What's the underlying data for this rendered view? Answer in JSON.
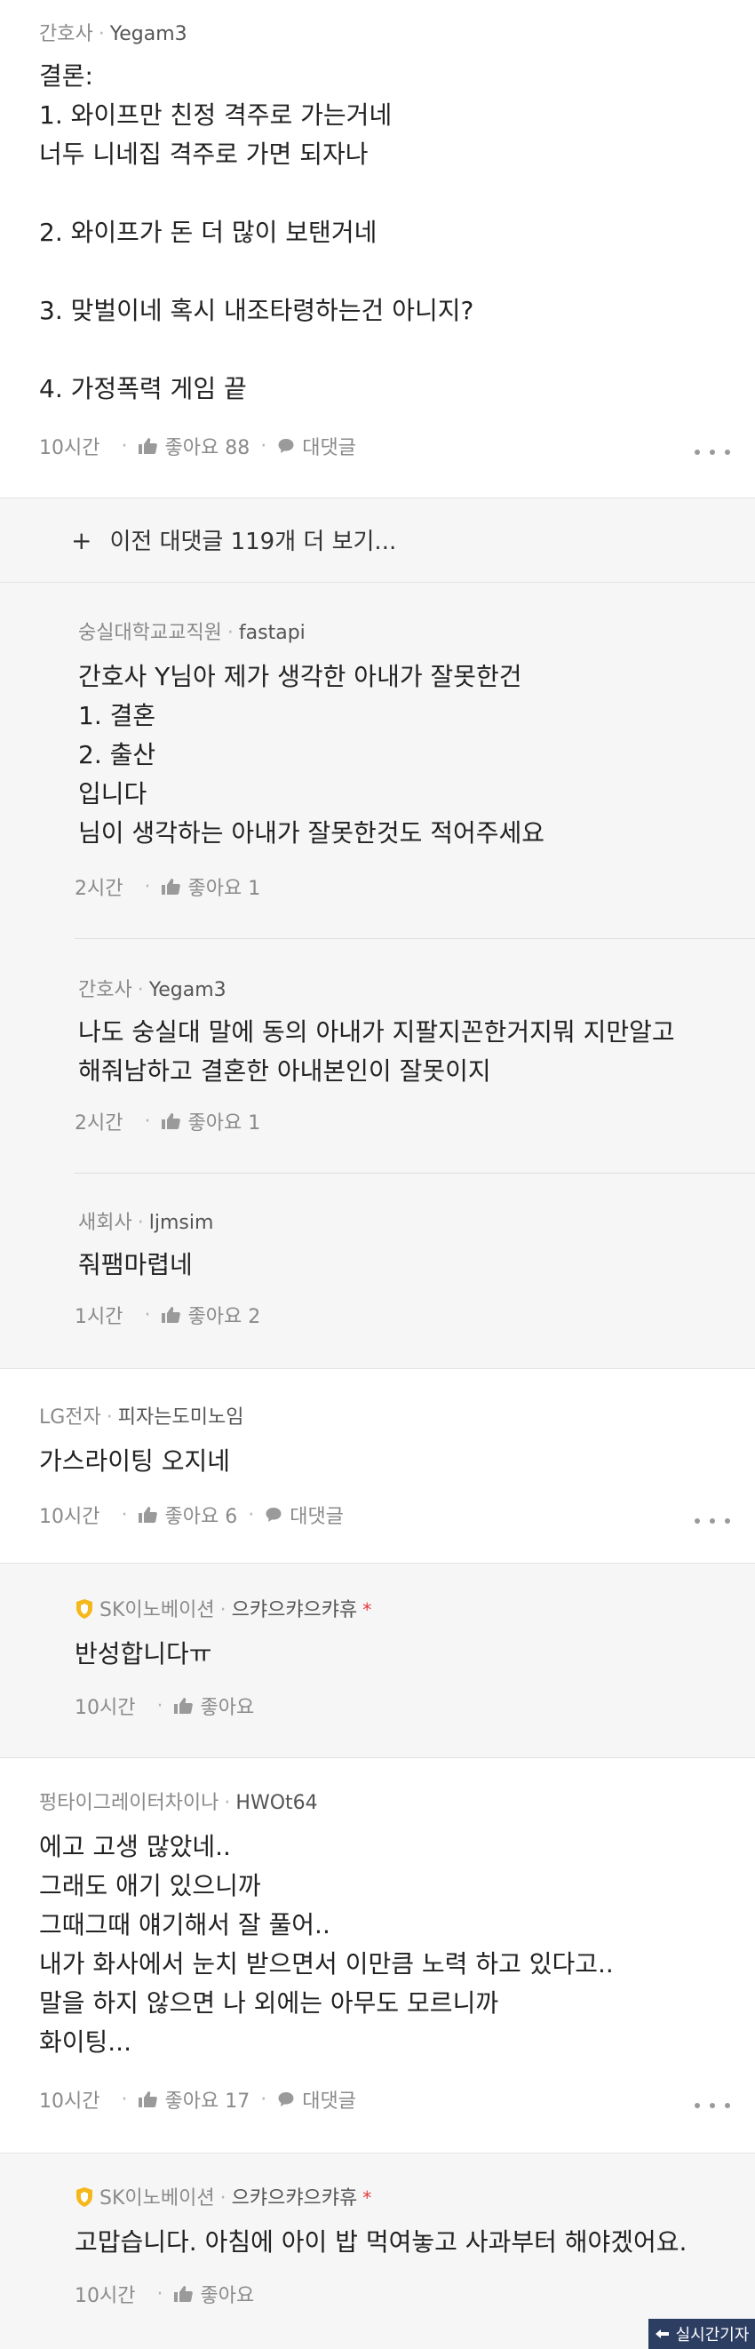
{
  "comments": [
    {
      "company": "간호사",
      "nickname": "Yegam3",
      "lines": [
        "결론:",
        "1. 와이프만 친정 격주로 가는거네",
        "너두 니네집 격주로 가면 되자나",
        "",
        "2. 와이프가 돈 더 많이 보탠거네",
        "",
        "3. 맞벌이네 혹시 내조타령하는건 아니지?",
        "",
        "4. 가정폭력 게임 끝"
      ],
      "time": "10시간",
      "like_label": "좋아요 88",
      "reply_label": "대댓글"
    },
    {
      "company": "LG전자",
      "nickname": "피자는도미노임",
      "lines": [
        "가스라이팅 오지네"
      ],
      "time": "10시간",
      "like_label": "좋아요 6",
      "reply_label": "대댓글"
    },
    {
      "company": "펑타이그레이터차이나",
      "nickname": "HWOt64",
      "lines": [
        "에고 고생 많았네..",
        "그래도 애기 있으니까",
        "그때그때 얘기해서 잘 풀어..",
        "내가 화사에서 눈치 받으면서 이만큼 노력 하고 있다고..",
        "말을 하지 않으면 나 외에는 아무도 모르니까",
        "화이팅..."
      ],
      "time": "10시간",
      "like_label": "좋아요 17",
      "reply_label": "대댓글"
    }
  ],
  "load_more": {
    "plus": "+",
    "label": "이전 대댓글 119개 더 보기..."
  },
  "replies_1": [
    {
      "company": "숭실대학교교직원",
      "nickname": "fastapi",
      "lines": [
        "간호사 Y님아 제가 생각한 아내가 잘못한건",
        "1. 결혼",
        "2. 출산",
        "입니다",
        "님이 생각하는 아내가 잘못한것도 적어주세요"
      ],
      "time": "2시간",
      "like_label": "좋아요 1"
    },
    {
      "company": "간호사",
      "nickname": "Yegam3",
      "lines": [
        "나도 숭실대 말에 동의 아내가 지팔지꼰한거지뭐 지만알고",
        "해줘남하고 결혼한 아내본인이 잘못이지"
      ],
      "time": "2시간",
      "like_label": "좋아요 1"
    },
    {
      "company": "새회사",
      "nickname": "ljmsim",
      "lines": [
        "줘팸마렵네"
      ],
      "time": "1시간",
      "like_label": "좋아요 2"
    }
  ],
  "replies_2": [
    {
      "company": "SK이노베이션",
      "nickname": "으캬으캬으캬휴",
      "author_mark": "*",
      "lines": [
        "반성합니다ㅠ"
      ],
      "time": "10시간",
      "like_label": "좋아요"
    }
  ],
  "replies_3": [
    {
      "company": "SK이노베이션",
      "nickname": "으캬으캬으캬휴",
      "author_mark": "*",
      "lines": [
        "고맙습니다. 아침에 아이 밥 먹여놓고 사과부터 해야겠어요."
      ],
      "time": "10시간",
      "like_label": "좋아요"
    }
  ],
  "watermark": "실시간기자",
  "colors": {
    "badge_yellow": "#f5b81c",
    "reply_bg": "#f6f6f6",
    "watermark_bg": "#2d3e63"
  }
}
